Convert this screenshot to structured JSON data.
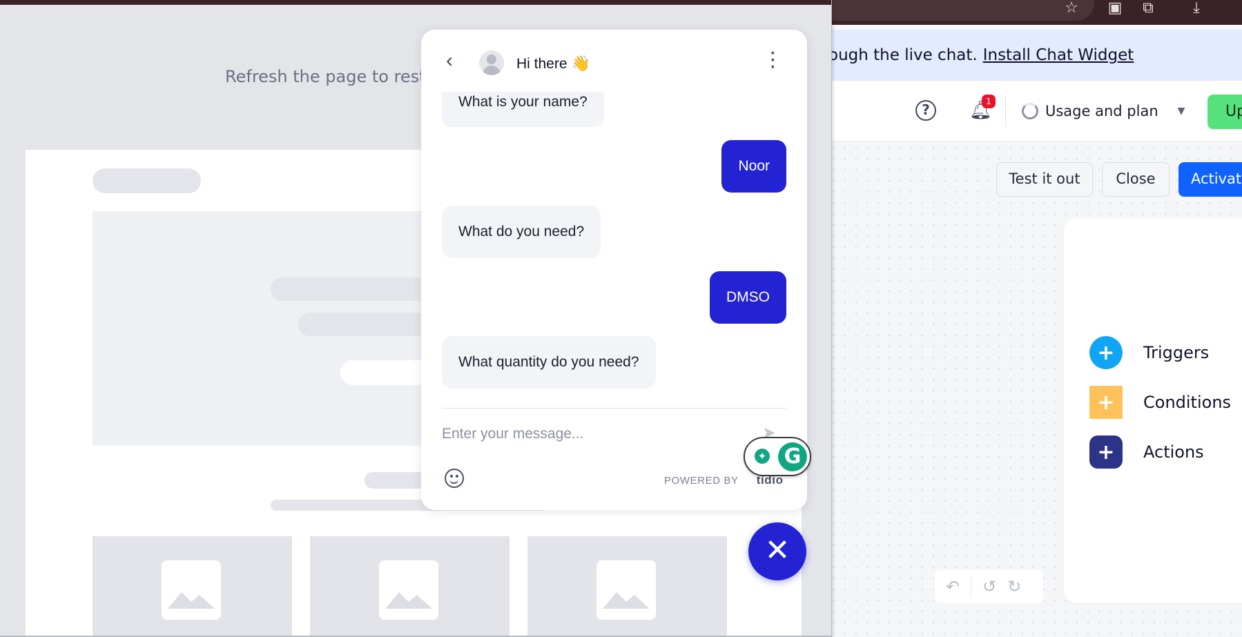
{
  "banner": {
    "text": "ough the live chat.",
    "link": "Install Chat Widget"
  },
  "topbar": {
    "notification_count": "1",
    "usage_label": "Usage and plan",
    "upgrade_label": "Up"
  },
  "builder": {
    "test_label": "Test it out",
    "close_label": "Close",
    "activate_label": "Activat",
    "nodes": {
      "triggers": "Triggers",
      "conditions": "Conditions",
      "actions": "Actions"
    }
  },
  "preview": {
    "refresh_text": "Refresh the page to restar"
  },
  "chat": {
    "title": "Hi there",
    "title_emoji": "👋",
    "messages": [
      {
        "from": "bot",
        "text": "What is your name?"
      },
      {
        "from": "user",
        "text": "Noor"
      },
      {
        "from": "bot",
        "text": "What do you need?"
      },
      {
        "from": "user",
        "text": "DMSO"
      },
      {
        "from": "bot",
        "text": "What quantity do you need?"
      }
    ],
    "input_placeholder": "Enter your message...",
    "powered_by": "POWERED BY",
    "brand": "tidio"
  },
  "colors": {
    "chat_accent": "#2323d4",
    "primary_button": "#0f62fe",
    "trigger": "#10a5f5",
    "condition": "#ffc25a",
    "action": "#2c3487"
  }
}
